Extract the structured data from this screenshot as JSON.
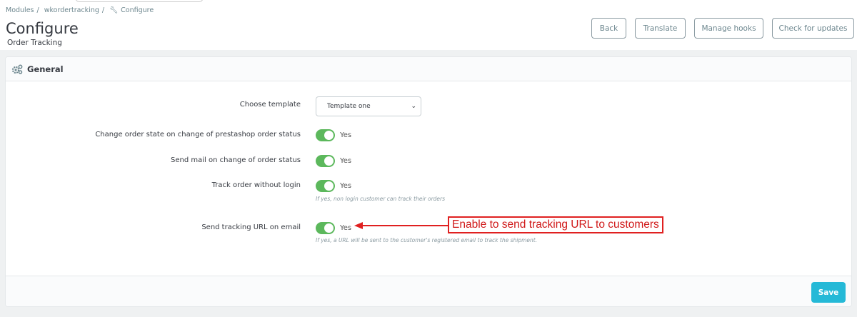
{
  "breadcrumb": [
    "Modules",
    "wkordertracking",
    "Configure"
  ],
  "page_title": "Configure",
  "page_subtitle": "Order Tracking",
  "toolbar": {
    "back": "Back",
    "translate": "Translate",
    "manage_hooks": "Manage hooks",
    "check_updates": "Check for updates"
  },
  "panel": {
    "title": "General",
    "fields": [
      {
        "label": "Choose template",
        "value": "Template one"
      },
      {
        "label": "Change order state on change of prestashop order status",
        "value": "Yes"
      },
      {
        "label": "Send mail on change of order status",
        "value": "Yes"
      },
      {
        "label": "Track order without login",
        "value": "Yes",
        "help": "If yes, non login customer can track their orders"
      },
      {
        "label": "Send tracking URL on email",
        "value": "Yes",
        "help": "If yes, a URL will be sent to the customer's registered email to track the shipment."
      }
    ],
    "save": "Save"
  },
  "annotation": "Enable to send tracking URL to customers",
  "colors": {
    "toggle_on": "#5cb85c",
    "primary": "#25b9d7",
    "annotation": "#e02020"
  }
}
